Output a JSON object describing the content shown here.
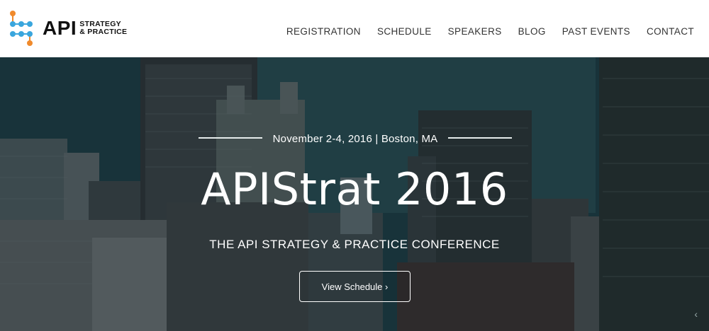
{
  "logo": {
    "api": "API",
    "line1": "STRATEGY",
    "line2": "& PRACTICE"
  },
  "nav": {
    "items": [
      "REGISTRATION",
      "SCHEDULE",
      "SPEAKERS",
      "BLOG",
      "PAST EVENTS",
      "CONTACT"
    ]
  },
  "hero": {
    "date": "November 2-4, 2016 | Boston, MA",
    "title": "APIStrat 2016",
    "subtitle": "THE API STRATEGY & PRACTICE CONFERENCE",
    "cta_label": "View Schedule ›"
  },
  "colors": {
    "logo_blue": "#3aa6dd",
    "logo_orange": "#f08a2c",
    "hero_tint": "#1f4248"
  }
}
